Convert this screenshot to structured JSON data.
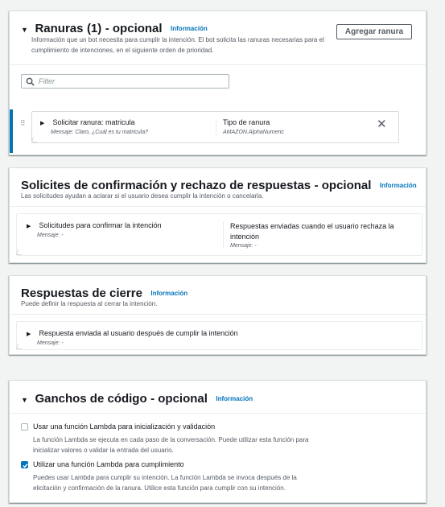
{
  "common": {
    "info_label": "Información"
  },
  "slots": {
    "title": "Ranuras",
    "count": "(1)",
    "optional": "- opcional",
    "description_line1": "Información que un bot necesita para cumplir la intención. El bot solicita las ranuras necesarias para el",
    "description_line2": "cumplimiento de intenciones, en el siguiente orden de prioridad.",
    "add_button": "Agregar ranura",
    "filter_placeholder": "Filter",
    "item": {
      "title": "Solicitar ranura: matricula",
      "message": "Mensaje: Claro, ¿Cuál es tu matricula?",
      "type_label": "Tipo de ranura",
      "type_value": "AMAZON.AlphaNumeric"
    }
  },
  "confirmation": {
    "title": "Solicites de confirmación y rechazo de respuestas",
    "optional": "- opcional",
    "description": "Las solicitudes ayudan a aclarar si el usuario desea cumplir la intención o cancelarla.",
    "left_title": "Solicitudes para confirmar la intención",
    "left_message": "Mensaje: -",
    "right_title_line1": "Respuestas enviadas cuando el usuario rechaza la",
    "right_title_line2": "intención",
    "right_message": "Mensaje: -"
  },
  "closing": {
    "title": "Respuestas de cierre",
    "description": "Puede definir la respuesta al cerrar la intención.",
    "item_title": "Respuesta enviada al usuario después de cumplir la intención",
    "item_message": "Mensaje: -"
  },
  "hooks": {
    "title": "Ganchos de código",
    "optional": "- opcional",
    "option1": {
      "label": "Usar una función Lambda para inicialización y validación",
      "desc_line1": "La función Lambda se ejecuta en cada paso de la conversación. Puede utilizar esta función para",
      "desc_line2": "inicializar valores o validar la entrada del usuario.",
      "checked": false
    },
    "option2": {
      "label": "Utilizar una función Lambda para cumplimiento",
      "desc_line1": "Puedes usar Lambda para cumplir su intención. La función Lambda se invoca después de la",
      "desc_line2": "elicitación y confirmación de la ranura. Utilice esta función para cumplir con su intención.",
      "checked": true
    }
  },
  "colors": {
    "accent": "#0073bb",
    "selected_bar": "#0073bb",
    "border": "#d5dbdb"
  }
}
